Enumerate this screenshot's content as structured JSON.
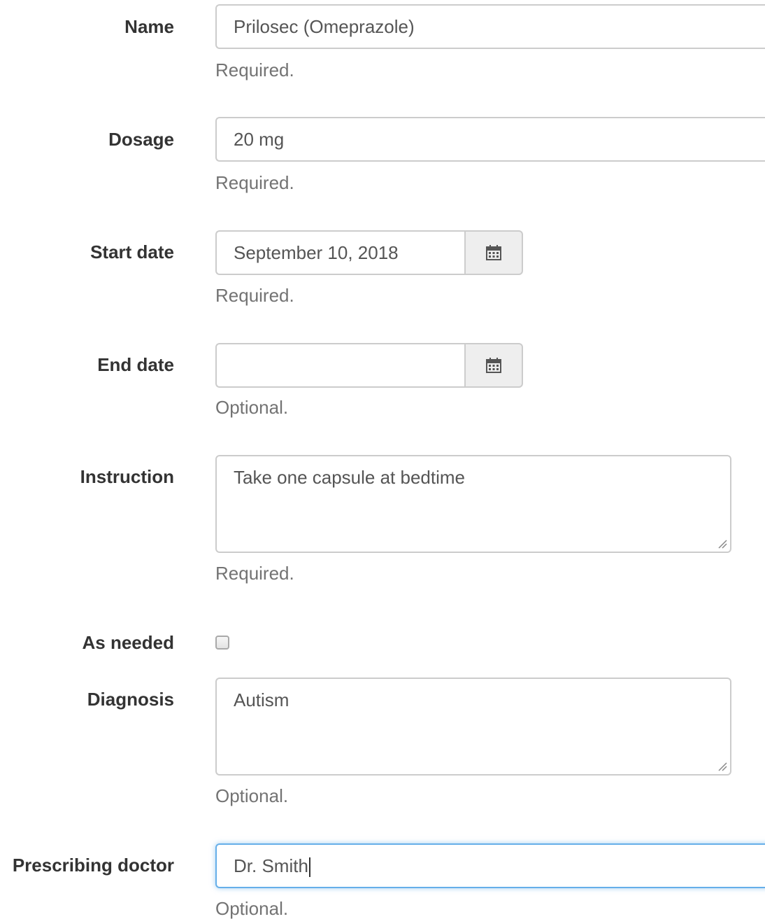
{
  "fields": {
    "name": {
      "label": "Name",
      "value": "Prilosec (Omeprazole)",
      "help": "Required."
    },
    "dosage": {
      "label": "Dosage",
      "value": "20 mg",
      "help": "Required."
    },
    "start_date": {
      "label": "Start date",
      "value": "September 10, 2018",
      "help": "Required.",
      "icon": "calendar-icon"
    },
    "end_date": {
      "label": "End date",
      "value": "",
      "help": "Optional.",
      "icon": "calendar-icon"
    },
    "instruction": {
      "label": "Instruction",
      "value": "Take one capsule at bedtime",
      "help": "Required."
    },
    "as_needed": {
      "label": "As needed",
      "checked": false
    },
    "diagnosis": {
      "label": "Diagnosis",
      "value": "Autism",
      "help": "Optional."
    },
    "prescribing_doctor": {
      "label": "Prescribing doctor",
      "value": "Dr. Smith",
      "help": "Optional.",
      "focused": true
    }
  },
  "colors": {
    "label": "#333333",
    "help_text": "#737373",
    "input_border": "#cccccc",
    "addon_bg": "#eeeeee",
    "focus_border": "#66afe9"
  }
}
